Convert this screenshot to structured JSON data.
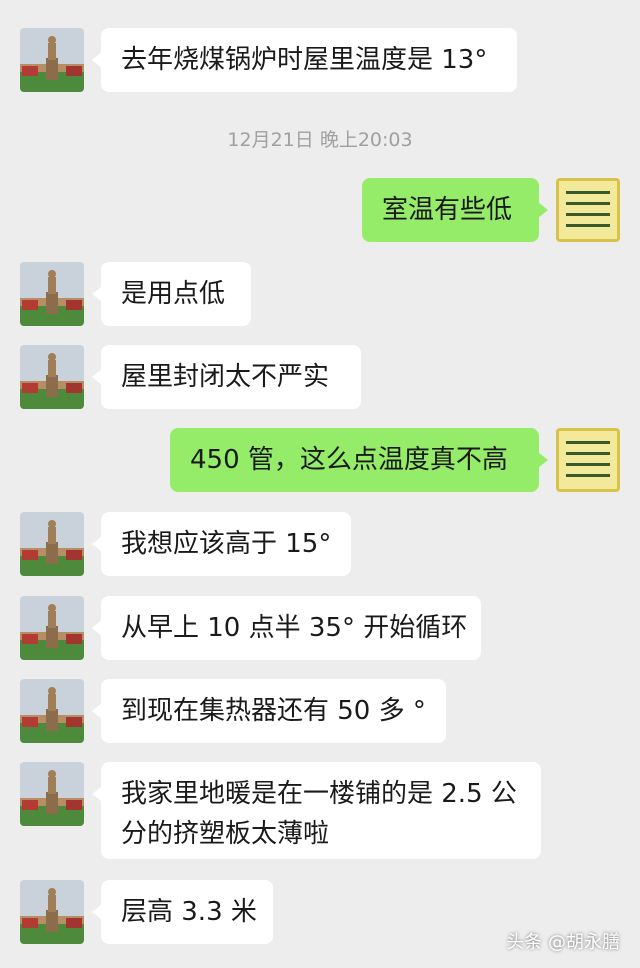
{
  "timestamp": "12月21日 晚上20:03",
  "watermark": "头条 @胡永膳",
  "messages": [
    {
      "side": "in",
      "text": "去年烧煤锅炉时屋里温度是 13°"
    },
    {
      "side": "out",
      "text": "室温有些低"
    },
    {
      "side": "in",
      "text": "是用点低"
    },
    {
      "side": "in",
      "text": "屋里封闭太不严实"
    },
    {
      "side": "out",
      "text": "450 管，这么点温度真不高"
    },
    {
      "side": "in",
      "text": "我想应该高于 15°"
    },
    {
      "side": "in",
      "text": "从早上 10 点半 35° 开始循环"
    },
    {
      "side": "in",
      "text": "到现在集热器还有 50 多 °"
    },
    {
      "side": "in",
      "text": "我家里地暖是在一楼铺的是 2.5 公分的挤塑板太薄啦"
    },
    {
      "side": "in",
      "text": "层高 3.3 米"
    }
  ],
  "colors": {
    "background": "#ededed",
    "incoming_bubble": "#ffffff",
    "outgoing_bubble": "#95ec69",
    "timestamp_text": "#a0a0a0"
  },
  "icons": {
    "incoming_avatar": "statue-avatar-icon",
    "outgoing_avatar": "calligraphy-avatar-icon"
  }
}
